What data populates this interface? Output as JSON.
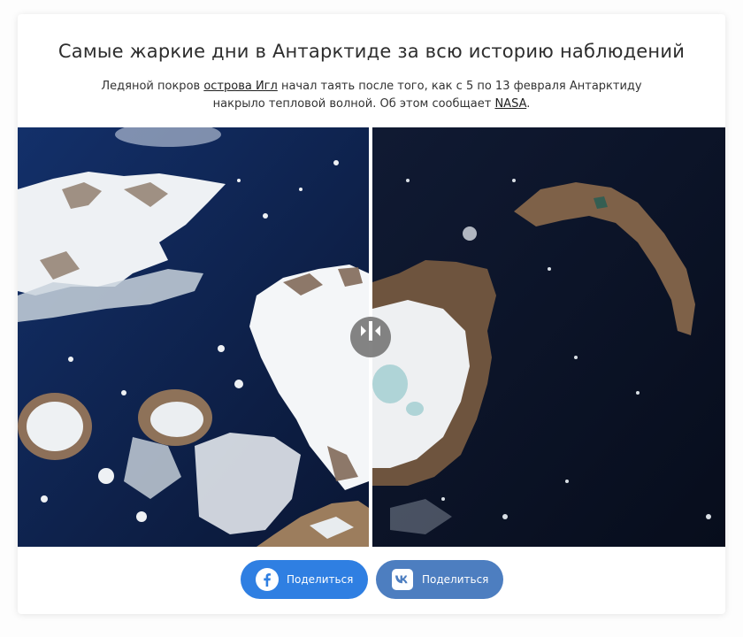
{
  "article": {
    "title": "Самые жаркие дни в Антарктиде за всю историю наблюдений",
    "desc_part1": "Ледяной покров ",
    "desc_link1": "острова Игл",
    "desc_part2": " начал таять после того, как с 5 по 13 февраля Антарктиду накрыло тепловой волной. Об этом сообщает ",
    "desc_link2": "NASA",
    "desc_part3": "."
  },
  "comparison": {
    "handle_icon": "left-right-arrows-icon",
    "colors": {
      "ocean_before": "#0c1d45",
      "ocean_after": "#0a1226",
      "ice": "#f2f4f6",
      "rock": "#8a6a4a"
    }
  },
  "share": {
    "facebook_label": "Поделиться",
    "vk_label": "Поделиться",
    "facebook_icon": "facebook-icon",
    "vk_icon": "vk-icon",
    "colors": {
      "facebook": "#2f7fe2",
      "vk": "#4d7ec0"
    }
  }
}
